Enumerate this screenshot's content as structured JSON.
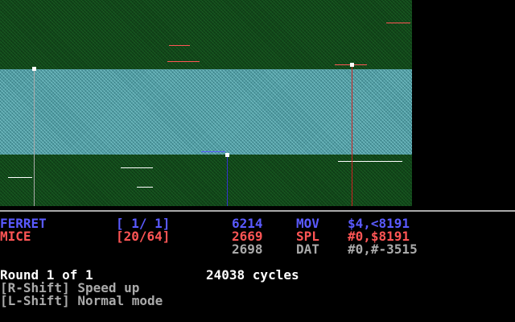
{
  "warriors": [
    {
      "name": "FERRET",
      "processes": "[ 1/ 1]",
      "cycles": "6214",
      "opcode": "MOV",
      "operands": "$4,<8191",
      "color": "#5a5aff"
    },
    {
      "name": "MICE",
      "processes": "[20/64]",
      "cycles": "2669",
      "opcode": "SPL",
      "operands": "#0,$8191",
      "color": "#ff5555"
    }
  ],
  "extra_row": {
    "cycles": "2698",
    "opcode": "DAT",
    "operands": "#0,#-3515",
    "color": "#aaaaaa"
  },
  "round": {
    "label": "Round 1 of 1",
    "cycles": "24038 cycles"
  },
  "hints": [
    "[R-Shift] Speed up",
    "[L-Shift] Normal mode"
  ],
  "colors": {
    "core_background": "#0f3d16",
    "core_band": "#4f9aa0",
    "pointer_ferret": "#3333cc",
    "pointer_mice": "#cc2222",
    "pointer_neutral": "#aaaaaa",
    "separator": "#aaaaaa"
  }
}
